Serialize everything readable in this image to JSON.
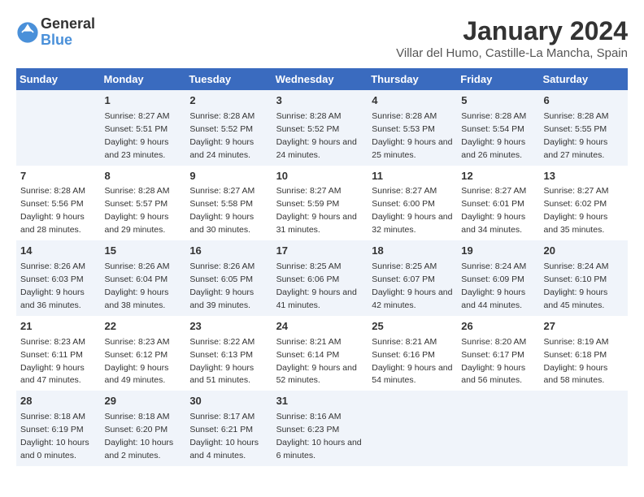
{
  "logo": {
    "general": "General",
    "blue": "Blue"
  },
  "title": "January 2024",
  "location": "Villar del Humo, Castille-La Mancha, Spain",
  "days_of_week": [
    "Sunday",
    "Monday",
    "Tuesday",
    "Wednesday",
    "Thursday",
    "Friday",
    "Saturday"
  ],
  "weeks": [
    [
      {
        "day": "",
        "sunrise": "",
        "sunset": "",
        "daylight": ""
      },
      {
        "day": "1",
        "sunrise": "8:27 AM",
        "sunset": "5:51 PM",
        "daylight": "9 hours and 23 minutes."
      },
      {
        "day": "2",
        "sunrise": "8:28 AM",
        "sunset": "5:52 PM",
        "daylight": "9 hours and 24 minutes."
      },
      {
        "day": "3",
        "sunrise": "8:28 AM",
        "sunset": "5:52 PM",
        "daylight": "9 hours and 24 minutes."
      },
      {
        "day": "4",
        "sunrise": "8:28 AM",
        "sunset": "5:53 PM",
        "daylight": "9 hours and 25 minutes."
      },
      {
        "day": "5",
        "sunrise": "8:28 AM",
        "sunset": "5:54 PM",
        "daylight": "9 hours and 26 minutes."
      },
      {
        "day": "6",
        "sunrise": "8:28 AM",
        "sunset": "5:55 PM",
        "daylight": "9 hours and 27 minutes."
      }
    ],
    [
      {
        "day": "7",
        "sunrise": "8:28 AM",
        "sunset": "5:56 PM",
        "daylight": "9 hours and 28 minutes."
      },
      {
        "day": "8",
        "sunrise": "8:28 AM",
        "sunset": "5:57 PM",
        "daylight": "9 hours and 29 minutes."
      },
      {
        "day": "9",
        "sunrise": "8:27 AM",
        "sunset": "5:58 PM",
        "daylight": "9 hours and 30 minutes."
      },
      {
        "day": "10",
        "sunrise": "8:27 AM",
        "sunset": "5:59 PM",
        "daylight": "9 hours and 31 minutes."
      },
      {
        "day": "11",
        "sunrise": "8:27 AM",
        "sunset": "6:00 PM",
        "daylight": "9 hours and 32 minutes."
      },
      {
        "day": "12",
        "sunrise": "8:27 AM",
        "sunset": "6:01 PM",
        "daylight": "9 hours and 34 minutes."
      },
      {
        "day": "13",
        "sunrise": "8:27 AM",
        "sunset": "6:02 PM",
        "daylight": "9 hours and 35 minutes."
      }
    ],
    [
      {
        "day": "14",
        "sunrise": "8:26 AM",
        "sunset": "6:03 PM",
        "daylight": "9 hours and 36 minutes."
      },
      {
        "day": "15",
        "sunrise": "8:26 AM",
        "sunset": "6:04 PM",
        "daylight": "9 hours and 38 minutes."
      },
      {
        "day": "16",
        "sunrise": "8:26 AM",
        "sunset": "6:05 PM",
        "daylight": "9 hours and 39 minutes."
      },
      {
        "day": "17",
        "sunrise": "8:25 AM",
        "sunset": "6:06 PM",
        "daylight": "9 hours and 41 minutes."
      },
      {
        "day": "18",
        "sunrise": "8:25 AM",
        "sunset": "6:07 PM",
        "daylight": "9 hours and 42 minutes."
      },
      {
        "day": "19",
        "sunrise": "8:24 AM",
        "sunset": "6:09 PM",
        "daylight": "9 hours and 44 minutes."
      },
      {
        "day": "20",
        "sunrise": "8:24 AM",
        "sunset": "6:10 PM",
        "daylight": "9 hours and 45 minutes."
      }
    ],
    [
      {
        "day": "21",
        "sunrise": "8:23 AM",
        "sunset": "6:11 PM",
        "daylight": "9 hours and 47 minutes."
      },
      {
        "day": "22",
        "sunrise": "8:23 AM",
        "sunset": "6:12 PM",
        "daylight": "9 hours and 49 minutes."
      },
      {
        "day": "23",
        "sunrise": "8:22 AM",
        "sunset": "6:13 PM",
        "daylight": "9 hours and 51 minutes."
      },
      {
        "day": "24",
        "sunrise": "8:21 AM",
        "sunset": "6:14 PM",
        "daylight": "9 hours and 52 minutes."
      },
      {
        "day": "25",
        "sunrise": "8:21 AM",
        "sunset": "6:16 PM",
        "daylight": "9 hours and 54 minutes."
      },
      {
        "day": "26",
        "sunrise": "8:20 AM",
        "sunset": "6:17 PM",
        "daylight": "9 hours and 56 minutes."
      },
      {
        "day": "27",
        "sunrise": "8:19 AM",
        "sunset": "6:18 PM",
        "daylight": "9 hours and 58 minutes."
      }
    ],
    [
      {
        "day": "28",
        "sunrise": "8:18 AM",
        "sunset": "6:19 PM",
        "daylight": "10 hours and 0 minutes."
      },
      {
        "day": "29",
        "sunrise": "8:18 AM",
        "sunset": "6:20 PM",
        "daylight": "10 hours and 2 minutes."
      },
      {
        "day": "30",
        "sunrise": "8:17 AM",
        "sunset": "6:21 PM",
        "daylight": "10 hours and 4 minutes."
      },
      {
        "day": "31",
        "sunrise": "8:16 AM",
        "sunset": "6:23 PM",
        "daylight": "10 hours and 6 minutes."
      },
      {
        "day": "",
        "sunrise": "",
        "sunset": "",
        "daylight": ""
      },
      {
        "day": "",
        "sunrise": "",
        "sunset": "",
        "daylight": ""
      },
      {
        "day": "",
        "sunrise": "",
        "sunset": "",
        "daylight": ""
      }
    ]
  ]
}
